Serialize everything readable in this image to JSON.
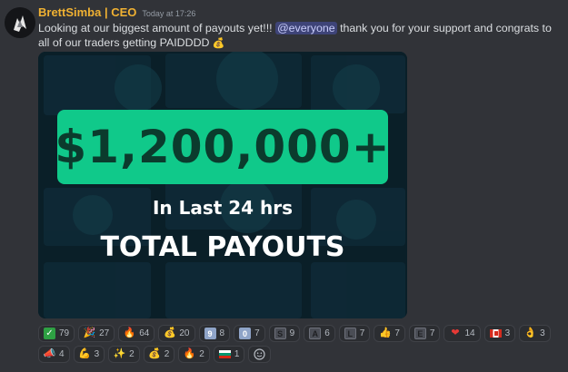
{
  "message": {
    "author": "BrettSimba | CEO",
    "timestamp": "Today at 17:26",
    "text_before_mention": "Looking at our biggest amount of payouts yet!!! ",
    "mention": "@everyone",
    "text_after_mention": " thank you for your support and congrats to all of our traders getting PAIDDDD ",
    "text_emoji": "💰",
    "author_color": "#f0b132"
  },
  "attachment": {
    "headline": "$1,200,000+",
    "subheadline": "In Last 24 hrs",
    "title": "TOTAL PAYOUTS",
    "accent": "#10c98a"
  },
  "reactions": [
    {
      "icon": "check-mark-icon",
      "glyph": "✓",
      "count": "79"
    },
    {
      "icon": "party-emoji-icon",
      "glyph": "🎉",
      "count": "27"
    },
    {
      "icon": "fire-icon",
      "glyph": "🔥",
      "count": "64"
    },
    {
      "icon": "money-bag-icon",
      "glyph": "💰",
      "count": "20"
    },
    {
      "icon": "keycap-9-icon",
      "glyph": "9",
      "count": "8"
    },
    {
      "icon": "keycap-0-icon",
      "glyph": "0",
      "count": "7"
    },
    {
      "icon": "letter-s-icon",
      "glyph": "S",
      "count": "9"
    },
    {
      "icon": "letter-a-icon",
      "glyph": "A",
      "count": "6"
    },
    {
      "icon": "letter-l-icon",
      "glyph": "L",
      "count": "7"
    },
    {
      "icon": "thumbs-up-icon",
      "glyph": "👍",
      "count": "7"
    },
    {
      "icon": "letter-e-icon",
      "glyph": "E",
      "count": "7"
    },
    {
      "icon": "heart-icon",
      "glyph": "❤",
      "count": "14"
    },
    {
      "icon": "canada-flag-icon",
      "glyph": "",
      "count": "3"
    },
    {
      "icon": "ok-hand-icon",
      "glyph": "👌",
      "count": "3"
    },
    {
      "icon": "megaphone-icon",
      "glyph": "📣",
      "count": "4"
    },
    {
      "icon": "flexed-biceps-icon",
      "glyph": "💪",
      "count": "3"
    },
    {
      "icon": "blue-sparkle-icon",
      "glyph": "✨",
      "count": "2"
    },
    {
      "icon": "money-bag-icon",
      "glyph": "💰",
      "count": "2"
    },
    {
      "icon": "fire-icon",
      "glyph": "🔥",
      "count": "2"
    },
    {
      "icon": "bulgaria-flag-icon",
      "glyph": "",
      "count": "1"
    }
  ],
  "add_reaction_icon": "add-reaction-icon"
}
